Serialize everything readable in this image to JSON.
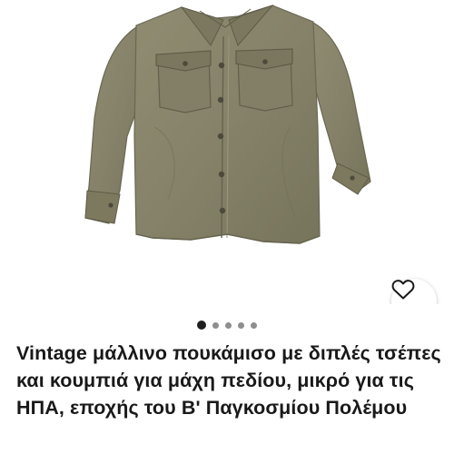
{
  "listing": {
    "title_bold": "Vintage",
    "title_rest": " μάλλινο πουκάμισο με διπλές τσέπες και κουμπιά για μάχη πεδίου, μικρό για τις ΗΠΑ, εποχής του Β' Παγκοσμίου Πολέμου"
  },
  "gallery": {
    "image_count": 5,
    "active_index": 0,
    "image_subject": "olive drab wool field shirt"
  },
  "icons": {
    "favorite": "heart-outline-icon"
  },
  "colors": {
    "shirt": "#8a876d",
    "shirt_shadow": "#6f6c55",
    "dot_active": "#1f1f1f",
    "dot_inactive": "#8e8e8e",
    "text": "#191919"
  }
}
